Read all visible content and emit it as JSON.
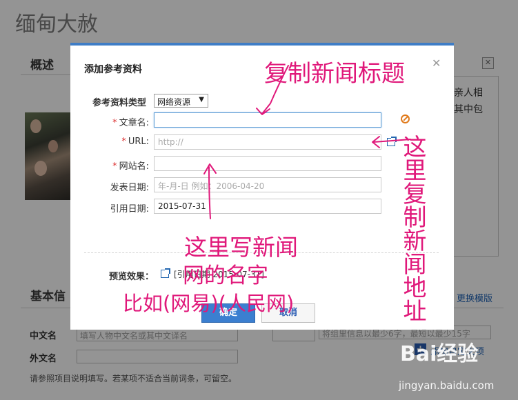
{
  "page": {
    "title": "缅甸大赦",
    "overview_heading": "概述",
    "basic_info_heading": "基本信",
    "bg_close_glyph": "✕",
    "side_text_1": "亲人相",
    "side_text_2": "其中包",
    "change_template_link": "更换模版",
    "chinese_name_label": "中文名",
    "chinese_name_placeholder": "填写人物中文名或其中文译名",
    "foreign_name_label": "外文名",
    "right_input_placeholder": "将组里信息以最少6字，最短以最少15字",
    "add_custom_plus": "+",
    "add_custom_link": "添加自定义项",
    "footer_note": "请参照项目说明填写。若某项不适合当前词条，可留空。",
    "watermark_brand": "Bai经验",
    "watermark_url": "jingyan.baidu.com"
  },
  "dialog": {
    "title": "添加参考资料",
    "close_glyph": "✕",
    "type_label": "参考资料类型",
    "type_value": "网络资源",
    "type_arrow": "▼",
    "fields": {
      "article_label": "文章名:",
      "article_value": "",
      "url_label": "URL:",
      "url_placeholder": "http://",
      "site_label": "网站名:",
      "site_value": "",
      "publish_label": "发表日期:",
      "publish_placeholder": "年-月-日 例如：2006-04-20",
      "cite_label": "引用日期:",
      "cite_value": "2015-07-31"
    },
    "required_mark": "*",
    "preview_label": "预览效果：",
    "preview_text": "[引用日期 2015-07-31]",
    "ok_button": "确定",
    "cancel_button": "取消"
  },
  "annotations": {
    "top": "复制新闻标题",
    "right": "这里复制新闻地址",
    "middle_1": "这里写新闻",
    "middle_2": "网的名字",
    "bottom": "比如(网易)(人民网)"
  },
  "colors": {
    "accent": "#3f7dc6",
    "annotation": "#e0187a",
    "required": "#d33333",
    "warning": "#e07a1b"
  }
}
